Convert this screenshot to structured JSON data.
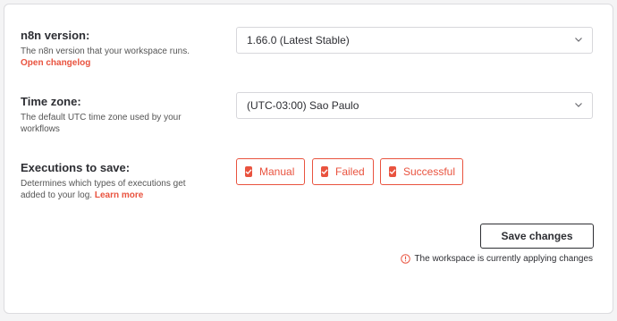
{
  "n8n_version": {
    "label": "n8n version:",
    "description": "The n8n version that your workspace runs.",
    "changelog_link": "Open changelog",
    "selected_value": "1.66.0 (Latest Stable)"
  },
  "time_zone": {
    "label": "Time zone:",
    "description": "The default UTC time zone used by your workflows",
    "selected_value": "(UTC-03:00) Sao Paulo"
  },
  "executions": {
    "label": "Executions to save:",
    "description": "Determines which types of executions get added to your log.",
    "learn_more": "Learn more",
    "options": [
      {
        "label": "Manual",
        "checked": true
      },
      {
        "label": "Failed",
        "checked": true
      },
      {
        "label": "Successful",
        "checked": true
      }
    ]
  },
  "save_button": "Save changes",
  "status_message": "The workspace is currently applying changes",
  "colors": {
    "accent": "#e9533f",
    "text": "#2d2e33",
    "border": "#d7d7db"
  }
}
